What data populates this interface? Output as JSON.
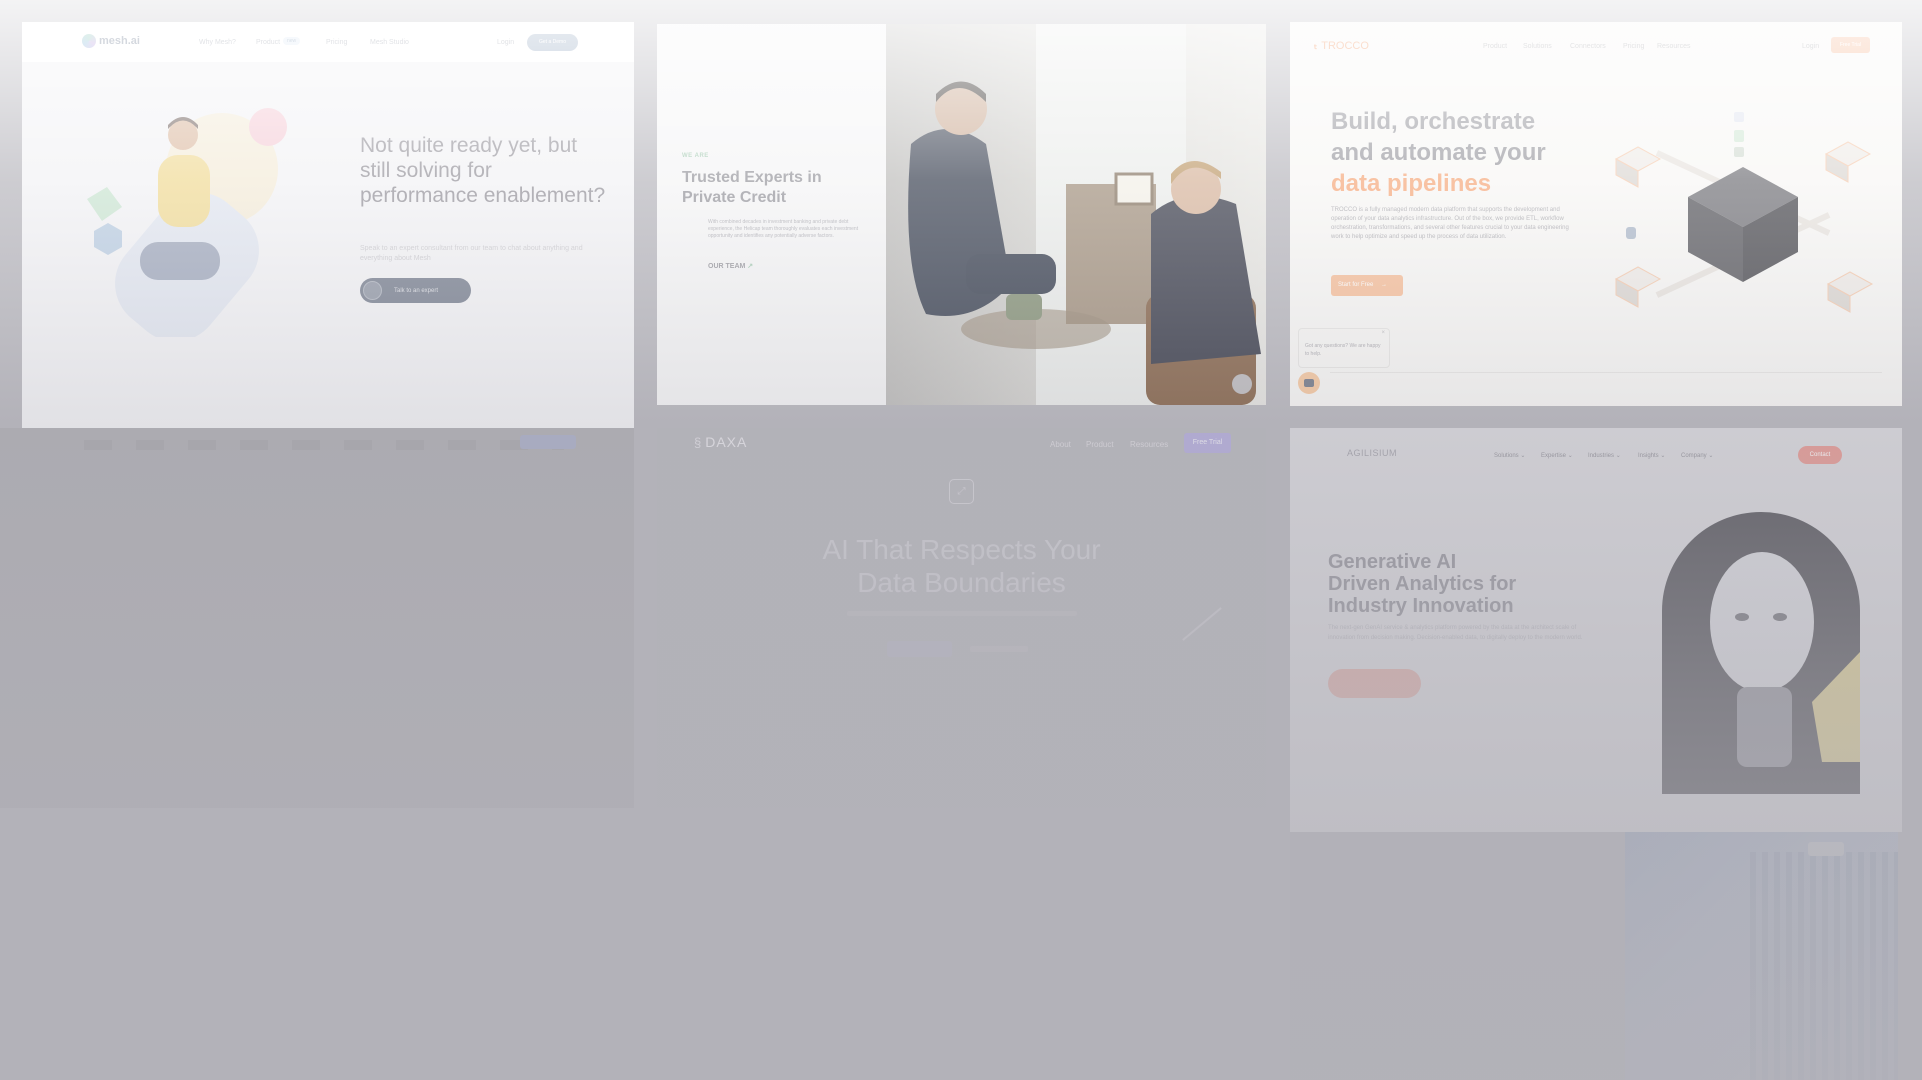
{
  "meshai": {
    "logo": "mesh.ai",
    "nav": [
      "Why Mesh?",
      "Product",
      "Pricing",
      "Mesh Studio"
    ],
    "product_badge": "new",
    "login": "Login",
    "demo_button": "Get a Demo",
    "headline": "Not quite ready yet, but still solving for performance enablement?",
    "subtext": "Speak to an expert consultant from our team to chat about anything and everything about Mesh",
    "cta": "Talk to an expert"
  },
  "credit": {
    "eyebrow": "WE ARE",
    "headline": "Trusted Experts in Private Credit",
    "body": "With combined decades in investment banking and private debt experience, the Helicap team thoroughly evaluates each investment opportunity and identifies any potentially adverse factors.",
    "link": "OUR TEAM"
  },
  "trocco": {
    "logo": "TROCCO",
    "nav": [
      "Product",
      "Solutions",
      "Connectors",
      "Pricing",
      "Resources"
    ],
    "login": "Login",
    "trial": "Free Trial",
    "headline_1": "Build, orchestrate",
    "headline_2": "and automate your",
    "headline_accent": "data pipelines",
    "body": "TROCCO is a fully managed modern data platform that supports the development and operation of your data analytics infrastructure. Out of the box, we provide ETL, workflow orchestration, transformations, and several other features crucial to your data engineering work to help optimize and speed up the process of data utilization.",
    "cta": "Start for Free",
    "chat_text": "Got any questions? We are happy to help."
  },
  "daxa": {
    "logo": "DAXA",
    "nav": [
      "About",
      "Product",
      "Resources"
    ],
    "trial": "Free Trial",
    "headline_1": "AI That Respects Your",
    "headline_2": "Data Boundaries"
  },
  "agilisium": {
    "logo": "AGILISIUM",
    "nav": [
      "Solutions",
      "Expertise",
      "Industries",
      "Insights",
      "Company"
    ],
    "contact": "Contact",
    "headline_1": "Generative AI",
    "headline_2": "Driven Analytics for",
    "headline_3": "Industry Innovation",
    "body": "The next-gen GenAI service & analytics platform powered by the data at the architect scale of innovation from decision making. Decision-enabled data, to digitally deploy to the modern world."
  },
  "colors": {
    "trocco_orange": "#f0894f",
    "agilisium_red": "#e8736b",
    "daxa_purple": "#8f7fe0",
    "mesh_blue": "#6f8aa9",
    "backdrop": "#b3b2b9"
  }
}
